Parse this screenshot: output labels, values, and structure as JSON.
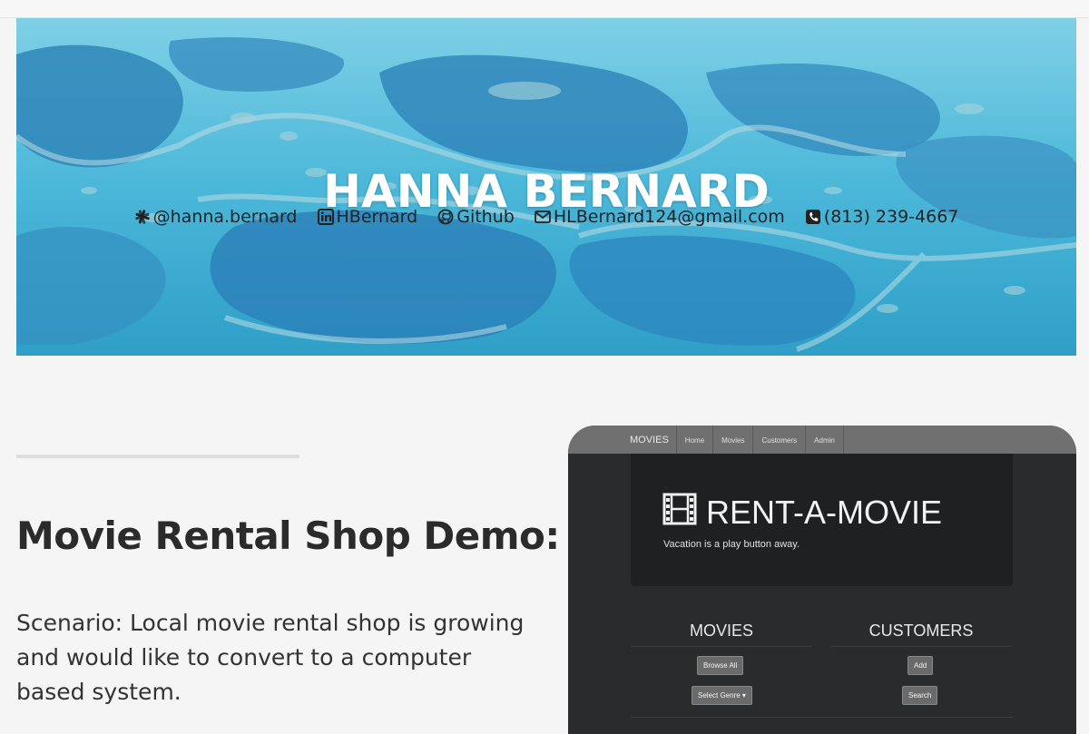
{
  "hero": {
    "name": "HANNA BERNARD",
    "contacts": [
      {
        "icon": "slack-icon",
        "label": "@hanna.bernard"
      },
      {
        "icon": "linkedin-icon",
        "label": "HBernard"
      },
      {
        "icon": "github-icon",
        "label": "Github"
      },
      {
        "icon": "envelope-icon",
        "label": "HLBernard124@gmail.com"
      },
      {
        "icon": "phone-icon",
        "label": "(813) 239-4667"
      }
    ]
  },
  "project": {
    "title": "Movie Rental Shop Demo:",
    "scenario": "Scenario: Local movie rental shop is growing and would like to convert to a computer based system."
  },
  "screenshot": {
    "nav": {
      "brand": "MOVIES",
      "items": [
        "Home",
        "Movies",
        "Customers",
        "Admin"
      ]
    },
    "logo_icon": "film-icon",
    "title": "RENT-A-MOVIE",
    "tagline": "Vacation is a play button away.",
    "columns": [
      {
        "heading": "MOVIES",
        "buttons": [
          "Browse All",
          "Select Genre ▾"
        ]
      },
      {
        "heading": "CUSTOMERS",
        "buttons": [
          "Add",
          "Search"
        ]
      }
    ]
  },
  "colors": {
    "page_bg": "#f5f5f5",
    "hero_water": "#4fb8d8",
    "mock_bg": "#2a2b2c",
    "mock_nav": "#707070"
  }
}
